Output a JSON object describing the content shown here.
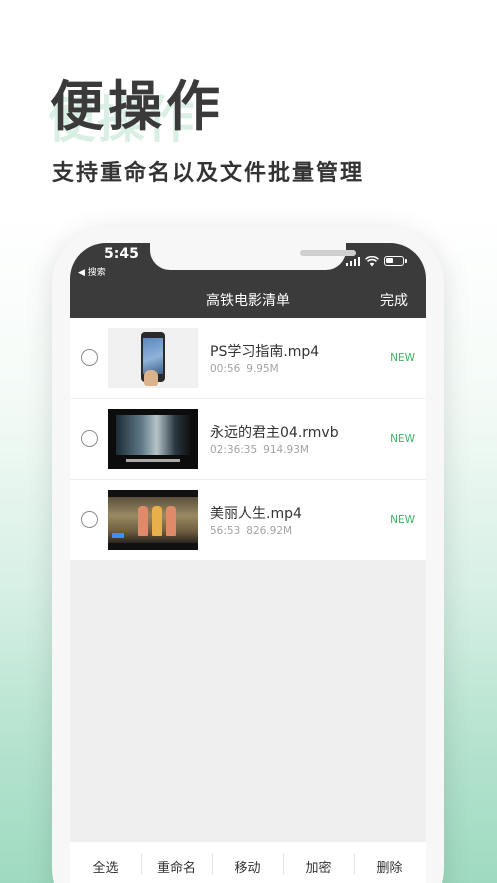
{
  "hero": {
    "title": "便操作",
    "subtitle": "支持重命名以及文件批量管理"
  },
  "status_bar": {
    "time": "5:45",
    "back_label": "◀ 搜索",
    "icons": [
      "signal-icon",
      "wifi-icon",
      "battery-icon"
    ]
  },
  "nav": {
    "title": "高铁电影清单",
    "done_label": "完成"
  },
  "files": [
    {
      "name": "PS学习指南.mp4",
      "duration": "00:56",
      "size": "9.95M",
      "badge": "NEW",
      "selected": false
    },
    {
      "name": "永远的君主04.rmvb",
      "duration": "02:36:35",
      "size": "914.93M",
      "badge": "NEW",
      "selected": false
    },
    {
      "name": "美丽人生.mp4",
      "duration": "56:53",
      "size": "826.92M",
      "badge": "NEW",
      "selected": false
    }
  ],
  "toolbar": {
    "select_all": "全选",
    "rename": "重命名",
    "move": "移动",
    "encrypt": "加密",
    "delete": "删除"
  },
  "colors": {
    "nav_background": "#3b3b3b",
    "badge_new": "#3fb561",
    "hero_gradient_bottom": "#9fdac0"
  }
}
